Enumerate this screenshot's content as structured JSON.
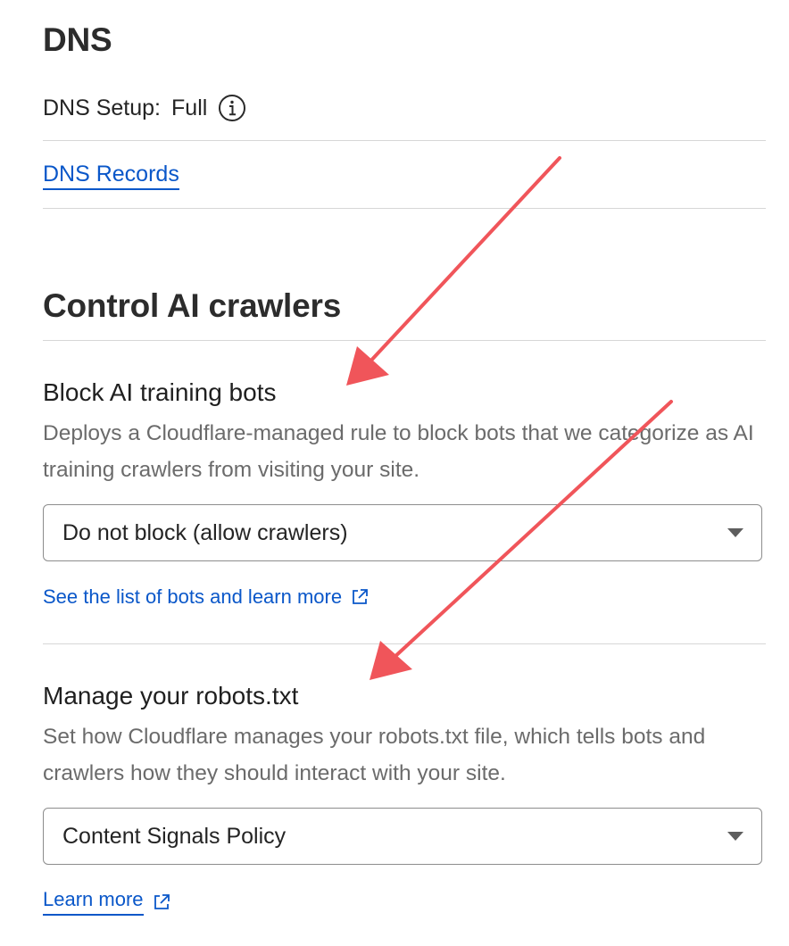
{
  "dns": {
    "title": "DNS",
    "setup_label": "DNS Setup:",
    "setup_value": "Full",
    "info_icon": "info-icon",
    "records_link": "DNS Records"
  },
  "ai": {
    "title": "Control AI crawlers",
    "block": {
      "heading": "Block AI training bots",
      "description": "Deploys a Cloudflare-managed rule to block bots that we categorize as AI training crawlers from visiting your site.",
      "select_value": "Do not block (allow crawlers)",
      "link": "See the list of bots and learn more",
      "link_icon": "external-link-icon"
    },
    "robots": {
      "heading": "Manage your robots.txt",
      "description": "Set how Cloudflare manages your robots.txt file, which tells bots and crawlers how they should interact with your site.",
      "select_value": "Content Signals Policy",
      "link": "Learn more",
      "link_icon": "external-link-icon"
    }
  },
  "colors": {
    "link": "#0a57c9",
    "annotation_arrow": "#f0555a",
    "divider": "#d7d7d7"
  }
}
